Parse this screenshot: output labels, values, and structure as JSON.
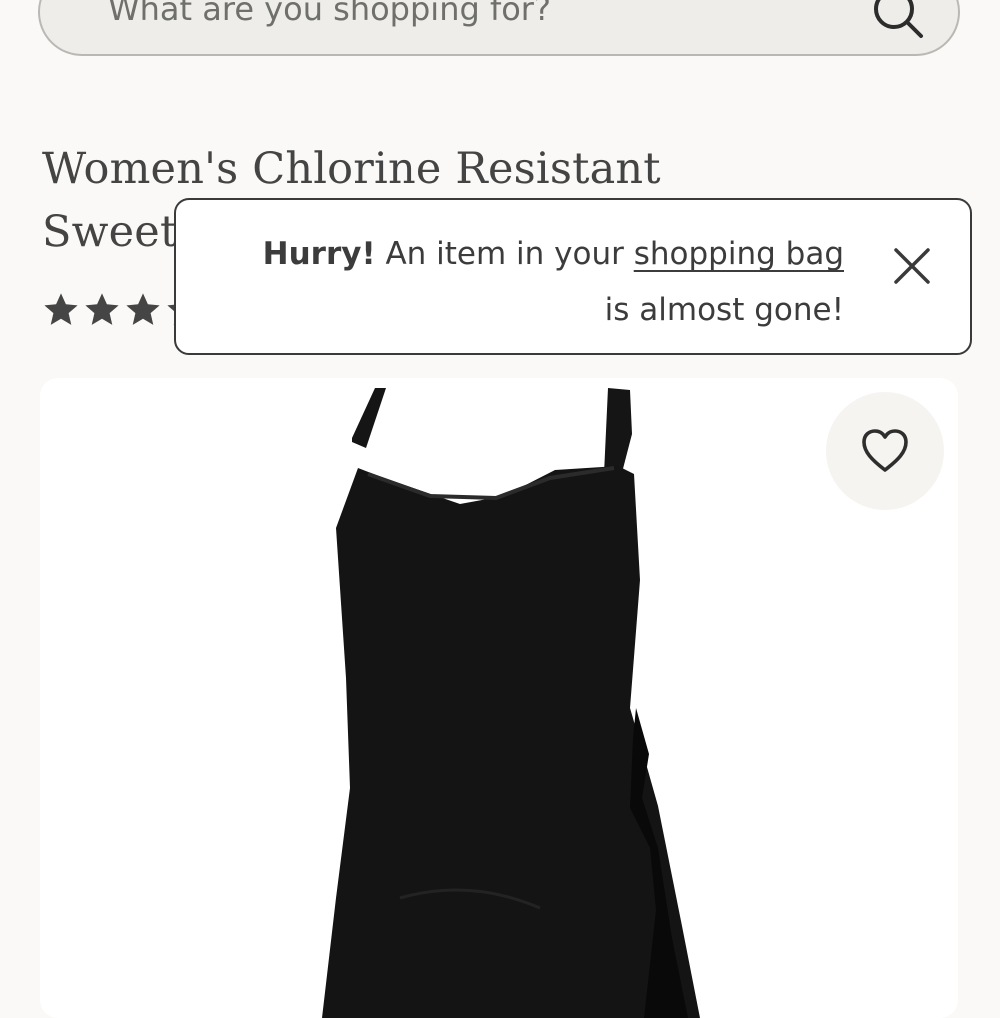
{
  "search": {
    "placeholder": "What are you shopping for?"
  },
  "product": {
    "title": "Women's Chlorine Resistant Sweetheart Swim",
    "rating_visible_stars": 4.5
  },
  "toast": {
    "strong": "Hurry!",
    "text_before_link": "An item in your",
    "link": "shopping bag",
    "text_after_link": "is almost gone!"
  },
  "icons": {
    "search": "search-icon",
    "close": "close-icon",
    "heart": "heart-icon",
    "star": "star-icon"
  },
  "colors": {
    "page_background": "#faf9f7",
    "search_background": "#eeede9",
    "text": "#444444",
    "toast_border": "#3a3a3a",
    "dress": "#141414"
  }
}
